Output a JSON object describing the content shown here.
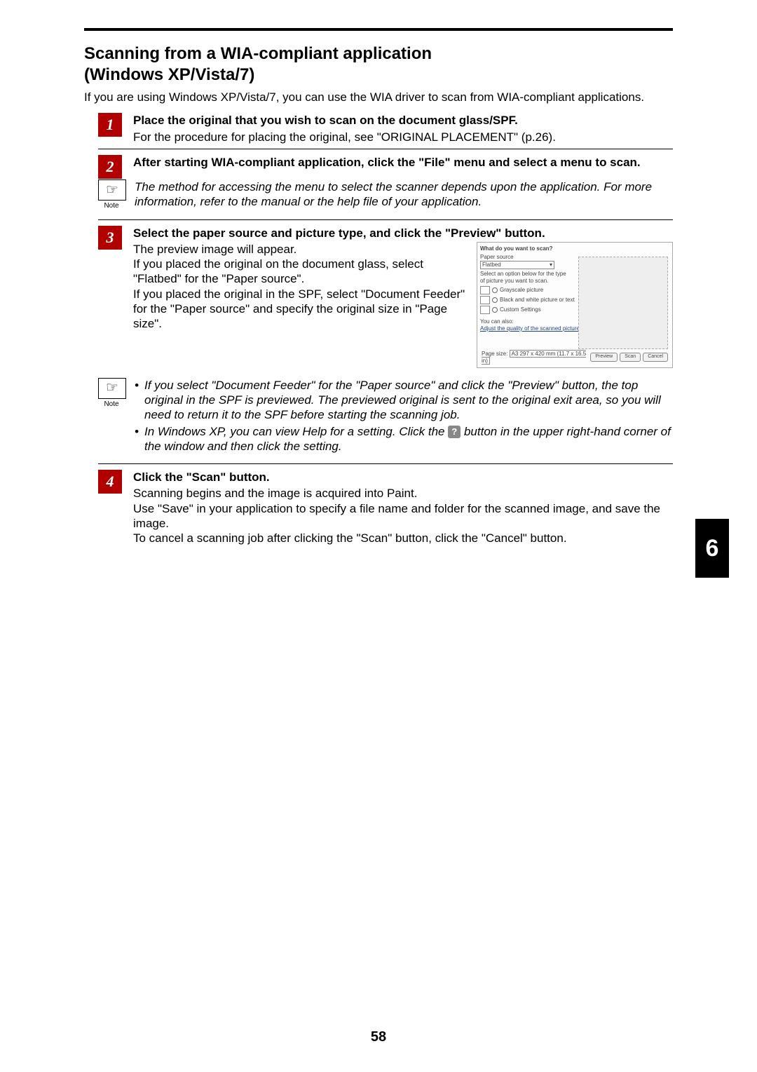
{
  "section_title_line1": "Scanning from a WIA-compliant application",
  "section_title_line2": "(Windows XP/Vista/7)",
  "intro": "If you are using Windows XP/Vista/7, you can use the WIA driver to scan from WIA-compliant applications.",
  "chapter_tab": "6",
  "page_number": "58",
  "note_label": "Note",
  "steps": {
    "s1": {
      "num": "1",
      "title": "Place the original that you wish to scan on the document glass/SPF.",
      "body": "For the procedure for placing the original, see \"ORIGINAL PLACEMENT\" (p.26)."
    },
    "s2": {
      "num": "2",
      "title": "After starting WIA-compliant application, click the \"File\" menu and select a menu to scan."
    },
    "note1": "The method for accessing the menu to select the scanner depends upon the application. For more information, refer to the manual or the help file of your application.",
    "s3": {
      "num": "3",
      "title": "Select the paper source and picture type, and click the \"Preview\" button.",
      "body1": "The preview image will appear.",
      "body2": "If you placed the original on the document glass, select \"Flatbed\" for the \"Paper source\".",
      "body3": "If you placed the original in the SPF, select \"Document Feeder\" for the \"Paper source\" and specify the original size in \"Page size\"."
    },
    "note2": {
      "b1": "If you select \"Document Feeder\" for the \"Paper source\" and click the \"Preview\" button, the top original in the SPF is previewed. The previewed original is sent to the original exit area, so you will need to return it to the SPF before starting the scanning job.",
      "b2a": "In Windows XP, you can view Help for a setting. Click the ",
      "b2b": " button in the upper right-hand corner of the window and then click the setting.",
      "help_glyph": "?"
    },
    "s4": {
      "num": "4",
      "title": "Click the \"Scan\" button.",
      "body1": "Scanning begins and the image is acquired into Paint.",
      "body2": "Use \"Save\" in your application to specify a file name and folder for the scanned image, and save the image.",
      "body3": "To cancel a scanning job after clicking the \"Scan\" button, click the \"Cancel\" button."
    }
  },
  "dialog": {
    "heading": "What do you want to scan?",
    "paper_source_label": "Paper source",
    "paper_source_value": "Flatbed",
    "options_hint": "Select an option below for the type of picture you want to scan.",
    "opt1": "Grayscale picture",
    "opt2": "Black and white picture or text",
    "opt3": "Custom Settings",
    "also": "You can also:",
    "adjust": "Adjust the quality of the scanned picture",
    "page_size_label": "Page size:",
    "page_size_value": "A3 297 x 420 mm (11.7 x 16.5 in)",
    "btn_preview": "Preview",
    "btn_scan": "Scan",
    "btn_cancel": "Cancel"
  }
}
